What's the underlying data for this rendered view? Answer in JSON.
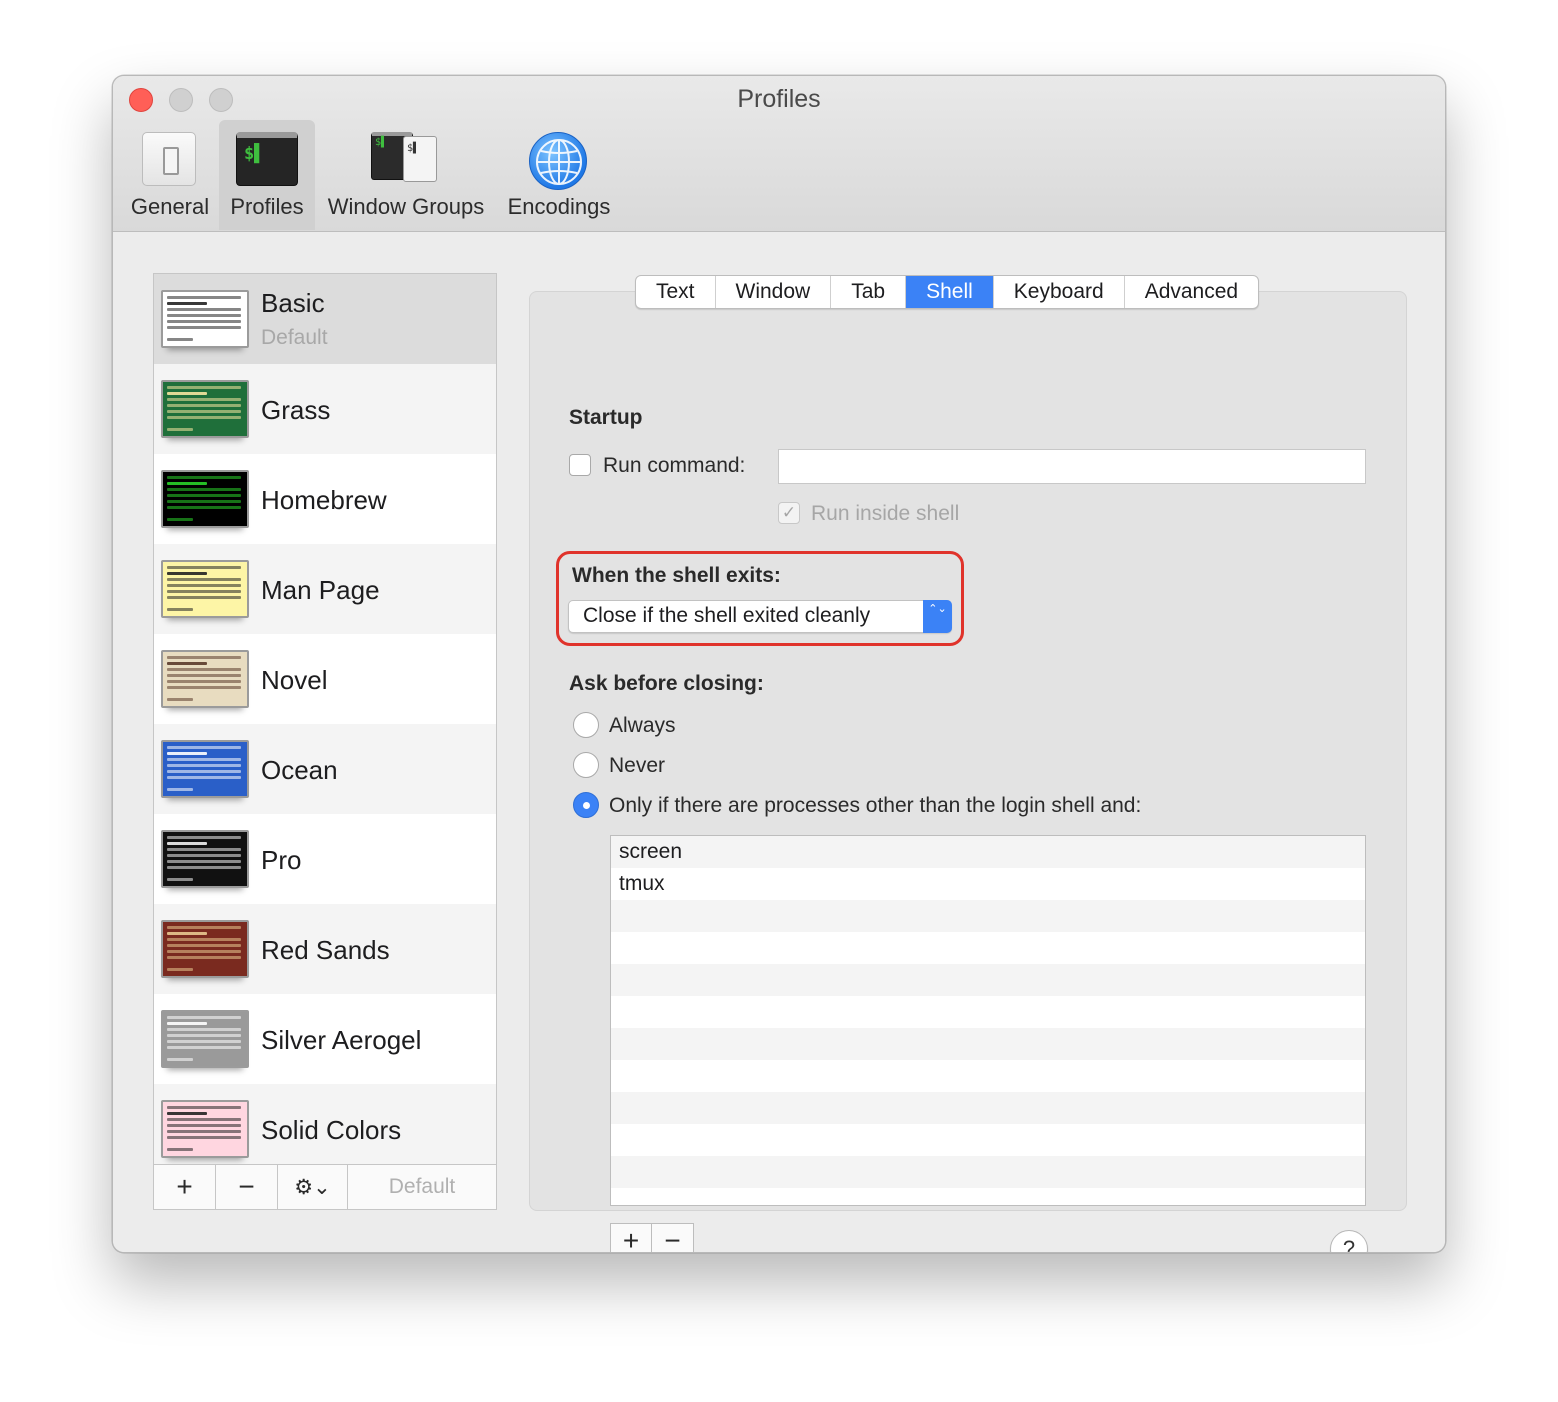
{
  "window": {
    "title": "Profiles",
    "close_color": "#ff5f57"
  },
  "toolbar": {
    "items": [
      {
        "label": "General",
        "icon": "switch-icon"
      },
      {
        "label": "Profiles",
        "icon": "terminal-icon",
        "active": true
      },
      {
        "label": "Window Groups",
        "icon": "window-groups-icon"
      },
      {
        "label": "Encodings",
        "icon": "globe-icon"
      }
    ],
    "terminal_glyph": "$▌",
    "terminal_glyph_small": "$▌"
  },
  "profiles": {
    "items": [
      {
        "name": "Basic",
        "subtitle": "Default",
        "selected": true,
        "bg": "#ffffff",
        "fg": "#222222"
      },
      {
        "name": "Grass",
        "bg": "#1f6f3a",
        "fg": "#f5e6a0"
      },
      {
        "name": "Homebrew",
        "bg": "#000000",
        "fg": "#29d129"
      },
      {
        "name": "Man Page",
        "bg": "#fdf5a6",
        "fg": "#222222"
      },
      {
        "name": "Novel",
        "bg": "#e8dcc0",
        "fg": "#5a3a2a"
      },
      {
        "name": "Ocean",
        "bg": "#2a5fc8",
        "fg": "#ffffff"
      },
      {
        "name": "Pro",
        "bg": "#111111",
        "fg": "#f2f2f2"
      },
      {
        "name": "Red Sands",
        "bg": "#7a2a1f",
        "fg": "#e8c890"
      },
      {
        "name": "Silver Aerogel",
        "bg": "#9a9a9a",
        "fg": "#ffffff"
      },
      {
        "name": "Solid Colors",
        "bg": "#ffd6e0",
        "fg": "#222222"
      }
    ],
    "add_label": "+",
    "remove_label": "−",
    "gear_label": "⚙⌄",
    "default_label": "Default"
  },
  "tabs": {
    "items": [
      "Text",
      "Window",
      "Tab",
      "Shell",
      "Keyboard",
      "Advanced"
    ],
    "active": "Shell",
    "accent": "#3b82f6"
  },
  "shell": {
    "startup_heading": "Startup",
    "run_command_label": "Run command:",
    "run_command_value": "",
    "run_inside_shell_label": "Run inside shell",
    "run_inside_shell_check": "✓",
    "exit_heading": "When the shell exits:",
    "exit_option": "Close if the shell exited cleanly",
    "popup_arrows": "⌃⌄",
    "ask_heading": "Ask before closing:",
    "radio_always": "Always",
    "radio_never": "Never",
    "radio_only_if": "Only if there are processes other than the login shell and:",
    "selected_radio": "Only if there are processes other than the login shell and:",
    "processes": [
      "screen",
      "tmux"
    ],
    "add_label": "+",
    "remove_label": "−",
    "help_label": "?",
    "highlight_color": "#e0332b"
  }
}
